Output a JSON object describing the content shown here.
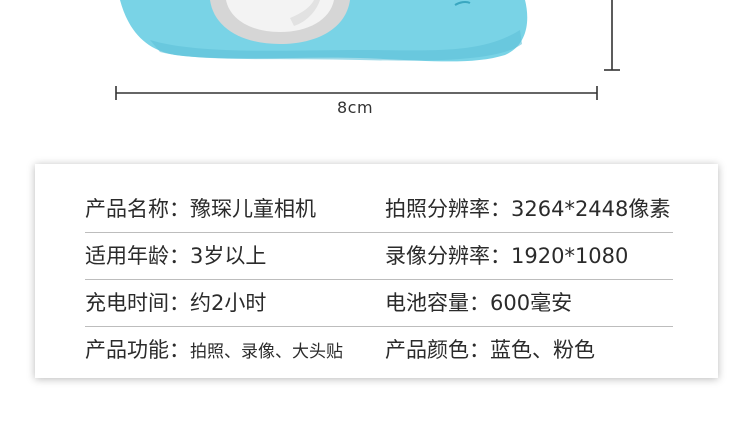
{
  "dimension": {
    "width_label": "8cm"
  },
  "specs": {
    "rows": [
      {
        "left_key": "产品名称：",
        "left_value": "豫琛儿童相机",
        "right_key": "拍照分辨率：",
        "right_value": "3264*2448像素"
      },
      {
        "left_key": "适用年龄：",
        "left_value": "3岁以上",
        "right_key": "录像分辨率：",
        "right_value": "1920*1080"
      },
      {
        "left_key": "充电时间：",
        "left_value": "约2小时",
        "right_key": "电池容量：",
        "right_value": "600毫安"
      },
      {
        "left_key": "产品功能：",
        "left_value": "拍照、录像、大头贴",
        "right_key": "产品颜色：",
        "right_value": "蓝色、粉色"
      }
    ]
  },
  "colors": {
    "camera_body": "#79d3e6",
    "camera_body_shadow": "#55bcd3",
    "lens_ring": "#d8d8d8",
    "lens_inner": "#f4f4f4"
  }
}
